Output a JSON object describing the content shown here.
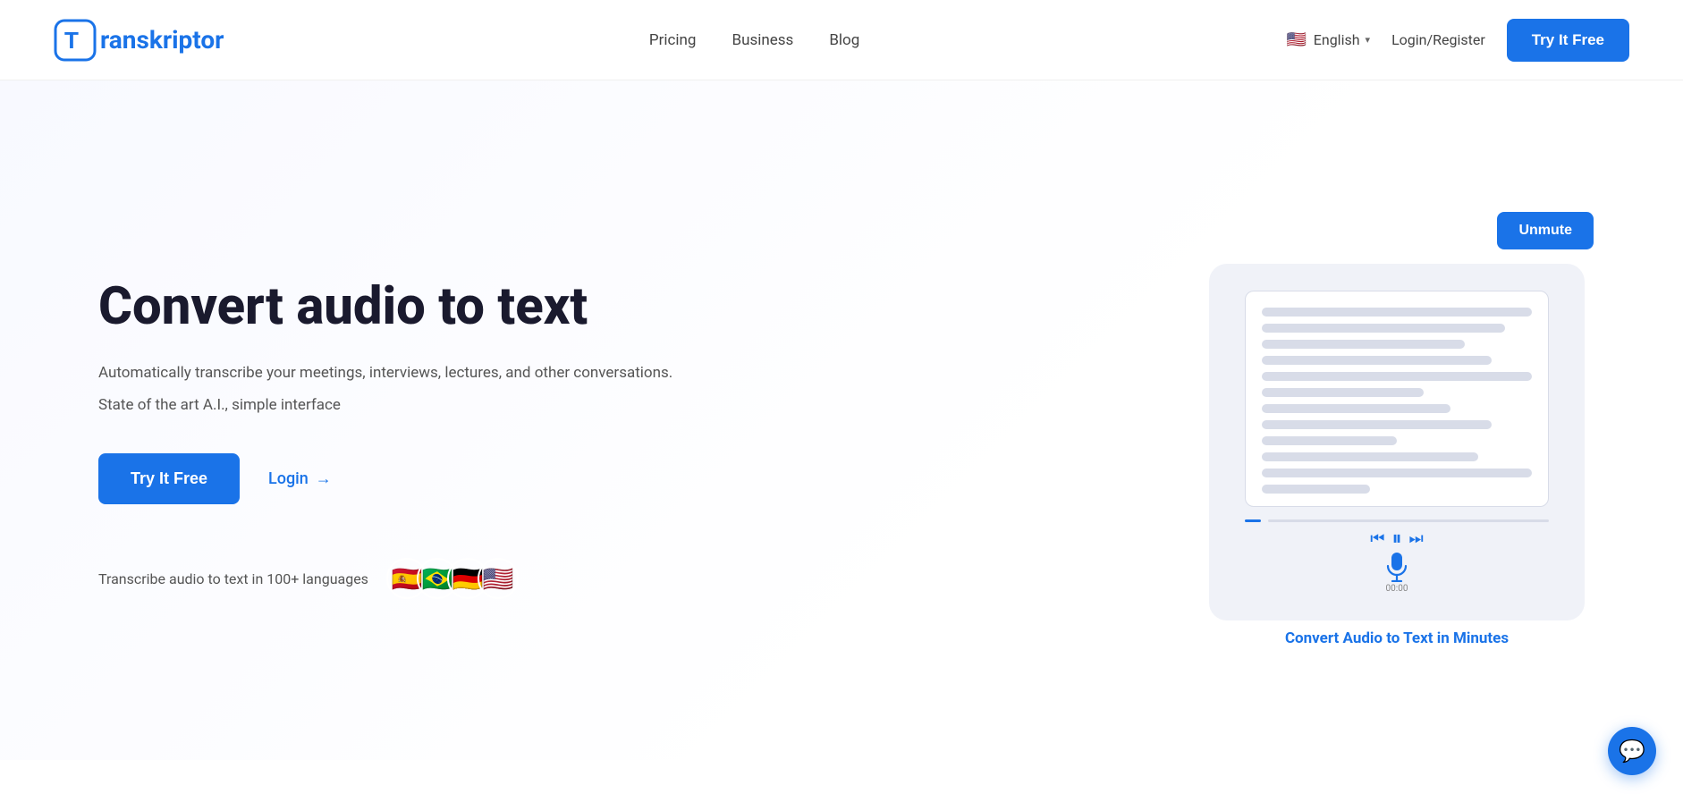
{
  "brand": {
    "logo_letter": "T",
    "name_prefix": "ranskriptor"
  },
  "navbar": {
    "links": [
      {
        "label": "Pricing",
        "href": "#"
      },
      {
        "label": "Business",
        "href": "#"
      },
      {
        "label": "Blog",
        "href": "#"
      }
    ],
    "language": {
      "flag": "🇺🇸",
      "label": "English",
      "chevron": "▾"
    },
    "login_label": "Login/Register",
    "cta_label": "Try It Free"
  },
  "hero": {
    "title": "Convert audio to text",
    "subtitle": "Automatically transcribe your meetings, interviews, lectures, and other conversations.",
    "subtitle2": "State of the art A.I., simple interface",
    "cta_label": "Try It Free",
    "login_label": "Login",
    "login_arrow": "→",
    "languages_text": "Transcribe audio to text in 100+ languages",
    "flags": [
      "🇪🇸",
      "🇧🇷",
      "🇩🇪",
      "🇺🇸"
    ]
  },
  "demo_card": {
    "unmute_label": "Unmute",
    "caption": "Convert Audio to Text in Minutes",
    "time_label": "00:00",
    "lines": [
      "full",
      "w90",
      "w75",
      "w85",
      "full",
      "w60",
      "w70",
      "w50",
      "w85",
      "w40",
      "w80",
      "full",
      "w60"
    ]
  },
  "chat": {
    "icon": "💬"
  }
}
